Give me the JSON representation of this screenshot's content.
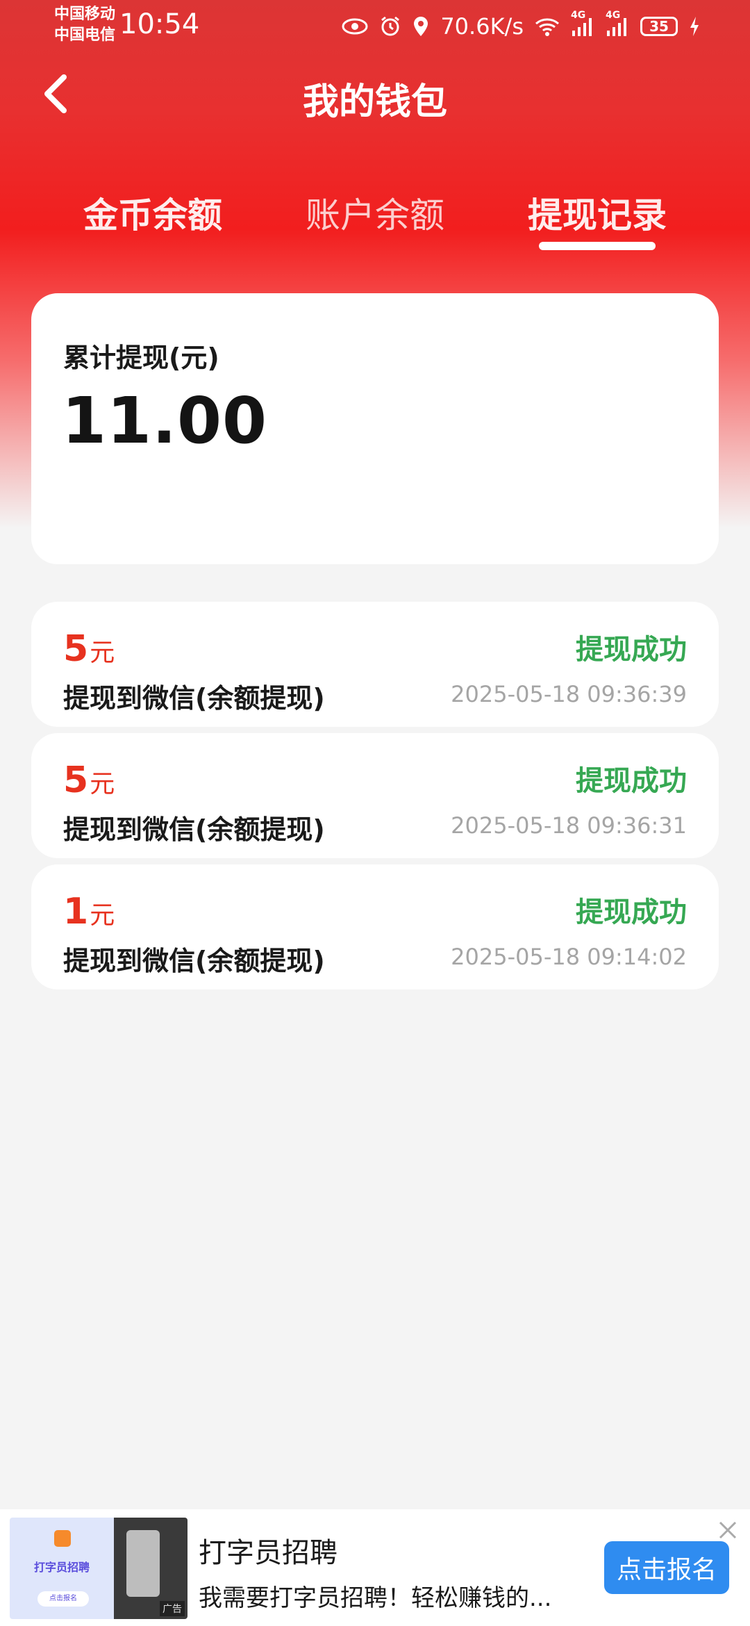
{
  "status_bar": {
    "carrier_1": "中国移动",
    "carrier_2": "中国电信",
    "time": "10:54",
    "net_speed": "70.6K/s",
    "signal_1": "4G",
    "signal_2": "4G",
    "battery": "35",
    "icons": [
      "eye-icon",
      "alarm-icon",
      "location-icon",
      "wifi-icon",
      "signal-icon",
      "charging-icon"
    ]
  },
  "header": {
    "title": "我的钱包"
  },
  "tabs": [
    {
      "label": "金币余额",
      "active": false
    },
    {
      "label": "账户余额",
      "active": false
    },
    {
      "label": "提现记录",
      "active": true
    }
  ],
  "summary": {
    "label": "累计提现(元)",
    "value": "11.00"
  },
  "records": [
    {
      "amount": "5",
      "unit": "元",
      "description": "提现到微信(余额提现)",
      "status": "提现成功",
      "time": "2025-05-18 09:36:39"
    },
    {
      "amount": "5",
      "unit": "元",
      "description": "提现到微信(余额提现)",
      "status": "提现成功",
      "time": "2025-05-18 09:36:31"
    },
    {
      "amount": "1",
      "unit": "元",
      "description": "提现到微信(余额提现)",
      "status": "提现成功",
      "time": "2025-05-18 09:14:02"
    }
  ],
  "ad": {
    "title": "打字员招聘",
    "subtitle": "我需要打字员招聘！轻松赚钱的...",
    "button": "点击报名",
    "thumb_text": "打字员招聘",
    "thumb_button": "点击报名",
    "thumb_tag": "广告"
  },
  "colors": {
    "header_red": "#e83030",
    "amount_red": "#e7321f",
    "status_green": "#36a853",
    "ad_button_blue": "#2f8cf0"
  }
}
